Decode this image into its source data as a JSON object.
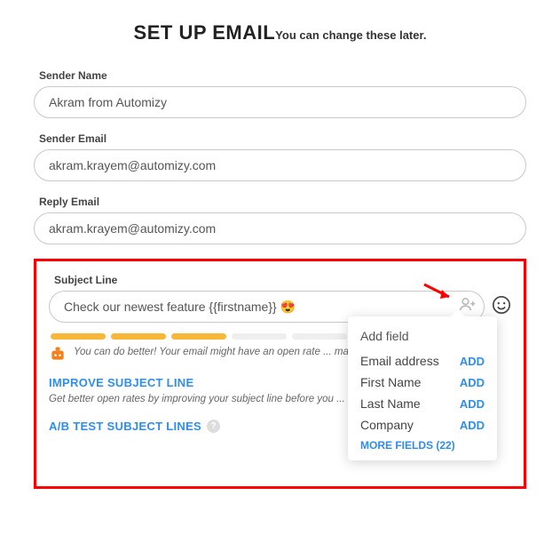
{
  "header": {
    "title": "SET UP EMAIL",
    "subtitle": "You can change these later."
  },
  "fields": {
    "senderName": {
      "label": "Sender Name",
      "value": "Akram from Automizy"
    },
    "senderEmail": {
      "label": "Sender Email",
      "value": "akram.krayem@automizy.com"
    },
    "replyEmail": {
      "label": "Reply Email",
      "value": "akram.krayem@automizy.com"
    },
    "subjectLine": {
      "label": "Subject Line",
      "value": "Check our newest feature {{firstname}} 😍"
    }
  },
  "score": {
    "filled": 3,
    "total": 5
  },
  "feedback": "You can do better! Your email might have an open rate ... marketers using Automizy.",
  "actions": {
    "improve": {
      "title": "IMPROVE SUBJECT LINE",
      "desc": "Get better open rates by improving your subject line before you ... write the best subject lines."
    },
    "abtest": {
      "title": "A/B TEST SUBJECT LINES"
    }
  },
  "popover": {
    "title": "Add field",
    "items": [
      {
        "name": "Email address",
        "action": "ADD"
      },
      {
        "name": "First Name",
        "action": "ADD"
      },
      {
        "name": "Last Name",
        "action": "ADD"
      },
      {
        "name": "Company",
        "action": "ADD"
      }
    ],
    "more": "MORE FIELDS (22)"
  },
  "help": "?"
}
